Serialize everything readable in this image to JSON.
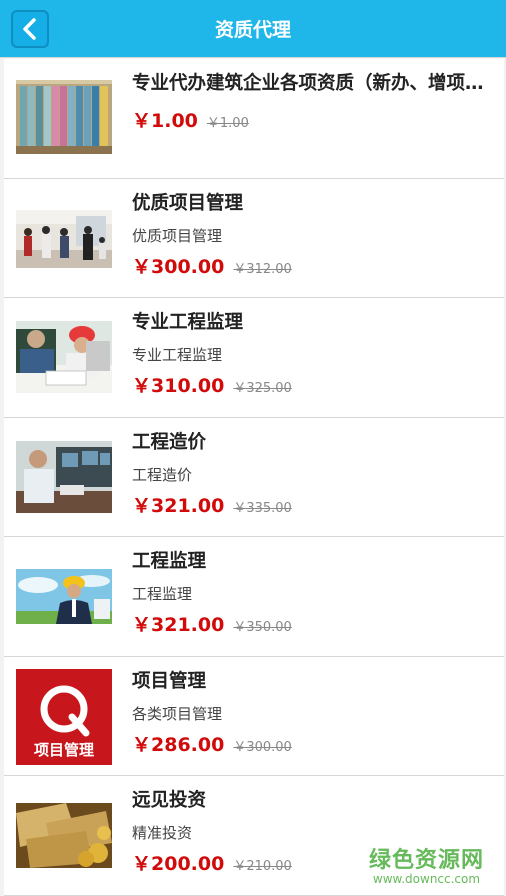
{
  "header": {
    "title": "资质代理",
    "back_icon": "chevron-left-icon"
  },
  "items": [
    {
      "title": "专业代办建筑企业各项资质（新办、增项、升级）",
      "desc": "",
      "price": "￥1.00",
      "old_price": "￥1.00",
      "image": "binders-shelf-photo"
    },
    {
      "title": "优质项目管理",
      "desc": "优质项目管理",
      "price": "￥300.00",
      "old_price": "￥312.00",
      "image": "office-people-photo"
    },
    {
      "title": "专业工程监理",
      "desc": "专业工程监理",
      "price": "￥310.00",
      "old_price": "￥325.00",
      "image": "hardhat-workers-photo"
    },
    {
      "title": "工程造价",
      "desc": "工程造价",
      "price": "￥321.00",
      "old_price": "￥335.00",
      "image": "computer-office-photo"
    },
    {
      "title": "工程监理",
      "desc": "工程监理",
      "price": "￥321.00",
      "old_price": "￥350.00",
      "image": "engineer-sky-photo"
    },
    {
      "title": "项目管理",
      "desc": "各类项目管理",
      "price": "￥286.00",
      "old_price": "￥300.00",
      "image": "project-management-logo",
      "image_text": "项目管理"
    },
    {
      "title": "远见投资",
      "desc": "精准投资",
      "price": "￥200.00",
      "old_price": "￥210.00",
      "image": "money-coins-photo"
    }
  ],
  "watermark": {
    "text": "绿色资源网",
    "url": "www.downcc.com"
  },
  "colors": {
    "header": "#1fb6ea",
    "price": "#d10a0a",
    "watermark": "#4caf3f"
  }
}
